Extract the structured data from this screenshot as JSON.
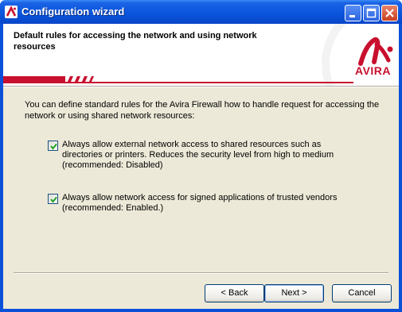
{
  "window": {
    "title": "Configuration wizard",
    "controls": [
      "minimize",
      "maximize",
      "close"
    ]
  },
  "header": {
    "title": "Default rules for accessing the network and using network resources",
    "logo_text": "AVIRA",
    "accent_color": "#c8102e"
  },
  "body": {
    "intro": "You can define standard rules for the Avira Firewall how to handle request for accessing the network or using shared network resources:",
    "options": [
      {
        "checked": true,
        "label": "Always allow external network access to shared resources such as directories or printers. Reduces the security level from high to medium (recommended: Disabled)"
      },
      {
        "checked": true,
        "label": "Always allow network access for signed applications of trusted vendors (recommended: Enabled.)"
      }
    ]
  },
  "buttons": {
    "back": "< Back",
    "next": "Next >",
    "cancel": "Cancel"
  }
}
